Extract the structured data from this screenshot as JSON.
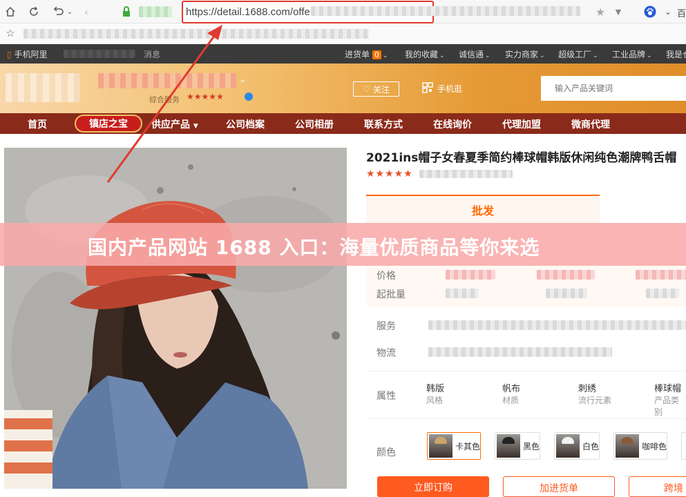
{
  "browser": {
    "url_visible": "https://detail.1688.com/offe",
    "icons": [
      "home-icon",
      "refresh-icon",
      "undo-icon",
      "back-icon",
      "lock-icon",
      "star-icon",
      "chevron-down-icon",
      "paw-icon",
      "bookmark-star-icon"
    ],
    "tab_label_right": "百"
  },
  "sitebar": {
    "mobile": "手机阿里",
    "messages": "消息",
    "cart": "进货单",
    "cart_count": "0",
    "favorites": "我的收藏",
    "trust": "诚信通",
    "power_merchant": "实力商家",
    "super_factory": "超级工厂",
    "industry_brand": "工业品牌",
    "my": "我是仓"
  },
  "shop": {
    "follow": "关注",
    "mobile_shop": "手机逛",
    "search_placeholder": "输入产品关键词",
    "rating_label": "综合服务",
    "stars": "★★★★★"
  },
  "nav": {
    "home": "首页",
    "badge": "镇店之宝",
    "supply": "供应产品",
    "profile": "公司档案",
    "album": "公司相册",
    "contact": "联系方式",
    "inquiry": "在线询价",
    "agency": "代理加盟",
    "wechat_agent": "微商代理"
  },
  "product": {
    "title": "2021ins帽子女春夏季简约棒球帽韩版休闲纯色潮牌鸭舌帽",
    "stars": "★★★★★",
    "tab_wholesale": "批发",
    "price_label": "价格",
    "moq_label": "起批量",
    "service_label": "服务",
    "logistics_label": "物流",
    "attr_label": "属性",
    "attributes": [
      {
        "value": "韩版",
        "key": "风格"
      },
      {
        "value": "帆布",
        "key": "材质"
      },
      {
        "value": "刺绣",
        "key": "流行元素"
      },
      {
        "value": "棒球帽",
        "key": "产品类别"
      }
    ],
    "color_label": "颜色",
    "colors": [
      "卡其色",
      "黑色",
      "白色",
      "咖啡色"
    ],
    "buy_now": "立即订购",
    "add_cart": "加进货单",
    "more": "跨境"
  },
  "banner": {
    "text": "国内产品网站 1688 入口：海量优质商品等你来选"
  },
  "colors": {
    "accent": "#ff6a00",
    "nav_bg": "#8a2a1a",
    "annotation_red": "#e03a2e"
  }
}
